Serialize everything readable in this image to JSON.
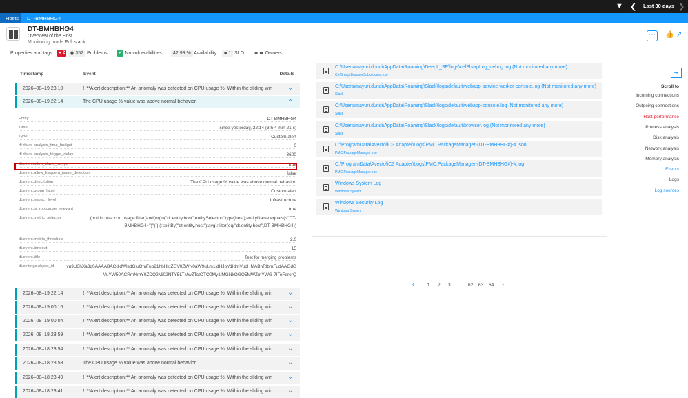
{
  "topbar": {
    "timeframe": "Last 30 days",
    "filter_icon": "filter-icon",
    "prev_icon": "chevron-left-icon",
    "next_icon": "chevron-right-icon"
  },
  "breadcrumb": {
    "hosts": "Hosts",
    "current": "DT-BMHBHG4"
  },
  "header": {
    "host_name": "DT-BMHBHG4",
    "subtitle": "Overview of the Host",
    "mode_label": "Monitoring mode",
    "mode_value": "Full stack",
    "more_label": "⋯"
  },
  "infobar": {
    "properties": "Properties and tags",
    "problems_count": "2",
    "problems_count2": "352",
    "problems_label": "Problems",
    "vulnerabilities": "No vulnerabilities",
    "availability_value": "42.99 %",
    "availability_label": "Availability",
    "slo_count": "1",
    "slo_label": "SLO",
    "owners_label": "Owners"
  },
  "events": {
    "headers": {
      "timestamp": "Timestamp",
      "event": "Event",
      "details": "Details"
    },
    "rows": [
      {
        "ts": "2026–08–19 23:10",
        "ev": "**Alert description:** An anomaly was detected on CPU usage %. Within the sliding win",
        "alert": true
      },
      {
        "ts": "2026–08–19 22:14",
        "ev": "The CPU usage % value was above normal behavior.",
        "alert": false
      },
      {
        "ts": "2026–08–19 22:14",
        "ev": "**Alert description:** An anomaly was detected on CPU usage %. Within the sliding win",
        "alert": true
      },
      {
        "ts": "2026–08–19 00:16",
        "ev": "**Alert description:** An anomaly was detected on CPU usage %. Within the sliding win",
        "alert": true
      },
      {
        "ts": "2026–08–19 00:04",
        "ev": "**Alert description:** An anomaly was detected on CPU usage %. Within the sliding win",
        "alert": true
      },
      {
        "ts": "2026–08–18 23:59",
        "ev": "**Alert description:** An anomaly was detected on CPU usage %. Within the sliding win",
        "alert": true
      },
      {
        "ts": "2026–08–18 23:54",
        "ev": "**Alert description:** An anomaly was detected on CPU usage %. Within the sliding win",
        "alert": true
      },
      {
        "ts": "2026–08–18 23:53",
        "ev": "The CPU usage % value was above normal behavior.",
        "alert": false
      },
      {
        "ts": "2026–08–18 23:49",
        "ev": "**Alert description:** An anomaly was detected on CPU usage %. Within the sliding win",
        "alert": true
      },
      {
        "ts": "2026–08–18 23:41",
        "ev": "**Alert description:** An anomaly was detected on CPU usage %. Within the sliding win",
        "alert": true
      }
    ],
    "details": [
      {
        "k": "Entity",
        "v": "DT-BMHBHG4"
      },
      {
        "k": "Time",
        "v": "since yesterday, 22:14 (3 h 4 min 21 s)"
      },
      {
        "k": "Type",
        "v": "Custom alert"
      },
      {
        "k": "dt.davis.analysis_time_budget",
        "v": "0"
      },
      {
        "k": "dt.davis.analysis_trigger_delay",
        "v": "3600"
      },
      {
        "k": "dt.event.allow_davis_merge",
        "v": "true"
      },
      {
        "k": "dt.event.allow_frequent_issue_detection",
        "v": "false"
      },
      {
        "k": "dt.event.description",
        "v": "The CPU usage % value was above normal behavior."
      },
      {
        "k": "dt.event.group_label",
        "v": "Custom alert"
      },
      {
        "k": "dt.event.impact_level",
        "v": "Infrastructure"
      },
      {
        "k": "dt.event.is_rootcause_relevant",
        "v": "true"
      },
      {
        "k": "dt.event.metric_selector",
        "v": "(builtin:host.cpu.usage:filter(and(or(in(\"dt.entity.host\",entitySelector(\"type(host),entityName.equals(~\"DT-",
        "v2": "BMHBHG4~\")\"))))):splitBy(\"dt.entity.host\"):avg):filter(eq(\"dt.entity.host\",DT-BMHBHG4))"
      },
      {
        "k": "dt.event.metric_threshold",
        "v": "2.0"
      },
      {
        "k": "dt.event.timeout",
        "v": "15"
      },
      {
        "k": "dt.event.title",
        "v": "Test for merging problems"
      },
      {
        "k": "dt.settings.object_id",
        "v": "vu9U3hXa3q0AAAABACdidWlsdGluOmFub21hbHktZGV0ZWN0aW9uLm1ldHJpY1ldmVudHMABnRlbmFudAAGdG",
        "v2": "VuYW50ACRmNmY0ZDQ2Mi02NTY5LTMwZTctOTQ0My1lMGNkOGQ5MWZmYWG-7ITeFdrerQ"
      }
    ]
  },
  "logs": {
    "rows": [
      {
        "path": "C:\\Users\\mayuri.dundi\\AppData\\Roaming\\DeepL_SE\\logs\\cefSharpLog_debug.log (Not monitored any more)",
        "src": "CefSharp.BrowserSubprocess.exe"
      },
      {
        "path": "C:\\Users\\mayuri.dundi\\AppData\\Roaming\\Slack\\logs\\default\\webapp-service-worker-console.log (Not monitored any more)",
        "src": "Slack"
      },
      {
        "path": "C:\\Users\\mayuri.dundi\\AppData\\Roaming\\Slack\\logs\\default\\webapp-console.log (Not monitored any more)",
        "src": "Slack"
      },
      {
        "path": "C:\\Users\\mayuri.dundi\\AppData\\Roaming\\Slack\\logs\\default\\browser.log (Not monitored any more)",
        "src": "Slack"
      },
      {
        "path": "C:\\ProgramData\\Avecto\\iC3 Adapter\\Logs\\PMC.PackageManager-(DT-BMHBHG#)-#.json",
        "src": "PMC.PackageManager.exe"
      },
      {
        "path": "C:\\ProgramData\\Avecto\\iC3 Adapter\\Logs\\PMC.PackageManager-(DT-BMHBHG#)-#.log",
        "src": "PMC.PackageManager.exe"
      },
      {
        "path": "Windows System Log",
        "src": "Windows System"
      },
      {
        "path": "Windows Security Log",
        "src": "Windows System"
      }
    ],
    "pagination": [
      "1",
      "2",
      "3",
      "…",
      "62",
      "63",
      "64"
    ]
  },
  "scrollto": {
    "title": "Scroll to",
    "items": [
      {
        "label": "Incoming connections",
        "state": "normal"
      },
      {
        "label": "Outgoing connections",
        "state": "normal"
      },
      {
        "label": "Host performance",
        "state": "active"
      },
      {
        "label": "Process analysis",
        "state": "normal"
      },
      {
        "label": "Disk analysis",
        "state": "normal"
      },
      {
        "label": "Network analysis",
        "state": "normal"
      },
      {
        "label": "Memory analysis",
        "state": "normal"
      },
      {
        "label": "Events",
        "state": "link"
      },
      {
        "label": "Logs",
        "state": "normal"
      },
      {
        "label": "Log sources",
        "state": "link"
      }
    ]
  },
  "colors": {
    "accent": "#1496ff",
    "active": "#dc172a",
    "teal": "#00a1b2",
    "topbar": "#1a1a1a"
  }
}
